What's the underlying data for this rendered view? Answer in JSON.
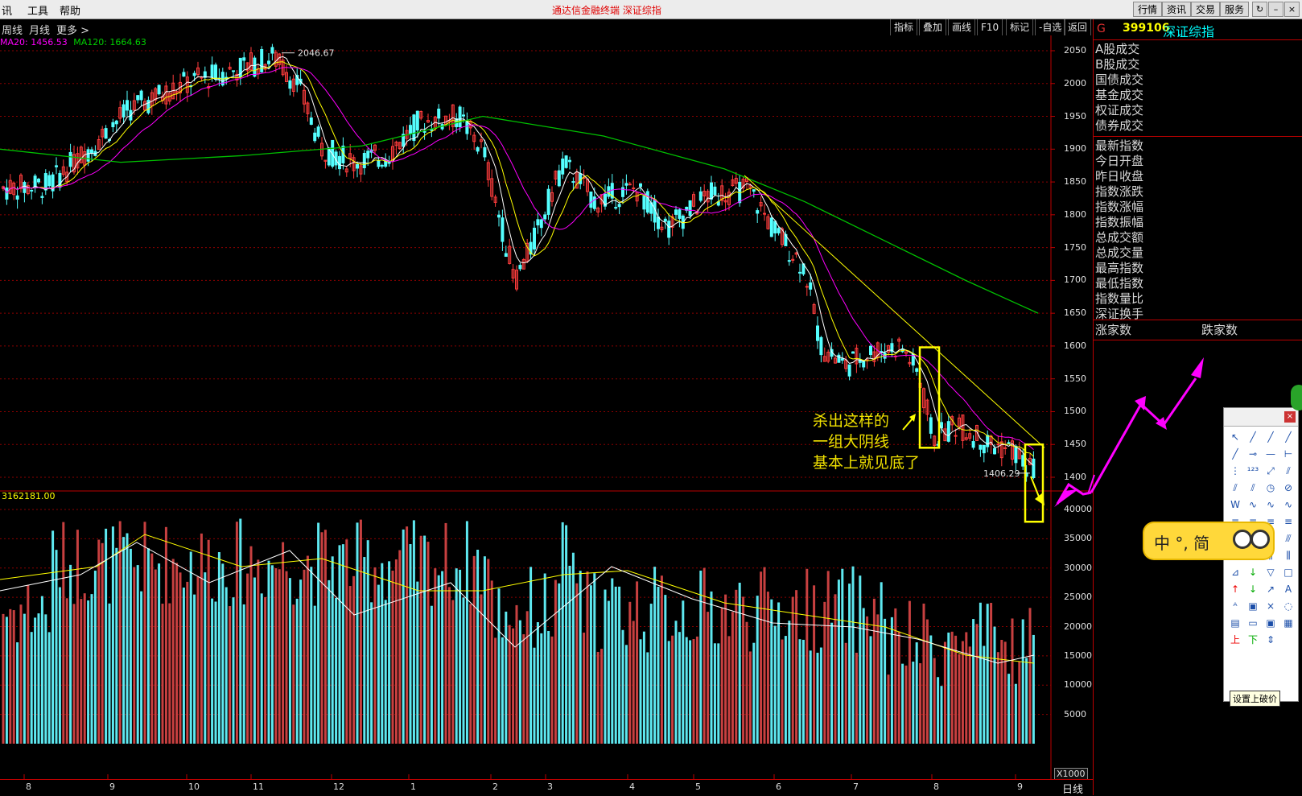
{
  "menu": {
    "items": [
      "讯",
      "工具",
      "帮助"
    ],
    "app_title": "通达信金融终端    深证综指"
  },
  "top_buttons": [
    "行情",
    "资讯",
    "交易",
    "服务"
  ],
  "window_buttons": [
    "↻",
    "–",
    "×"
  ],
  "period_tabs": [
    "周线",
    "月线",
    "更多 >"
  ],
  "chart_buttons": [
    "指标",
    "叠加",
    "画线",
    "F10",
    "标记",
    "-自选",
    "返回"
  ],
  "ma_legend": {
    "ma20": "MA20: 1456.53",
    "ma120": "MA120: 1664.63"
  },
  "colors": {
    "up": "#ff3d3d",
    "down": "#54ffff",
    "ma5": "#ffffff",
    "ma10": "#ffff00",
    "ma20": "#ff00ff",
    "ma120": "#00c000",
    "grid": "#8b0000",
    "annot": "#f0e000"
  },
  "price_axis": {
    "ticks": [
      "2050",
      "2000",
      "1950",
      "1900",
      "1850",
      "1800",
      "1750",
      "1700",
      "1650",
      "1600",
      "1550",
      "1500",
      "1450",
      "1400"
    ]
  },
  "price_labels": {
    "high": "2046.67",
    "low": "1406.29"
  },
  "volume_axis": {
    "header": "3162181.00",
    "ticks": [
      "40000",
      "35000",
      "30000",
      "25000",
      "20000",
      "15000",
      "10000",
      "5000"
    ],
    "unit": "X1000"
  },
  "x_axis": {
    "labels": [
      "8",
      "9",
      "10",
      "11",
      "12",
      "1",
      "2",
      "3",
      "4",
      "5",
      "6",
      "7",
      "8",
      "9"
    ],
    "period": "日线"
  },
  "annotation": {
    "lines": [
      "杀出这样的",
      "一组大阴线",
      "基本上就见底了"
    ]
  },
  "stock": {
    "prefix": "G",
    "code": "399106",
    "name": "深证综指"
  },
  "right_panel": {
    "group1": [
      "A股成交",
      "B股成交",
      "国债成交",
      "基金成交",
      "权证成交",
      "债券成交"
    ],
    "group2": [
      "最新指数",
      "今日开盘",
      "昨日收盘",
      "指数涨跌",
      "指数涨幅",
      "指数振幅",
      "总成交额",
      "总成交量",
      "最高指数",
      "最低指数",
      "指数量比",
      "深证换手"
    ],
    "rise_label": "涨家数",
    "fall_label": "跌家数"
  },
  "toolbox": {
    "tooltip": "设置上破价",
    "close": "×"
  },
  "ime": {
    "text": "中 °, 简"
  }
}
